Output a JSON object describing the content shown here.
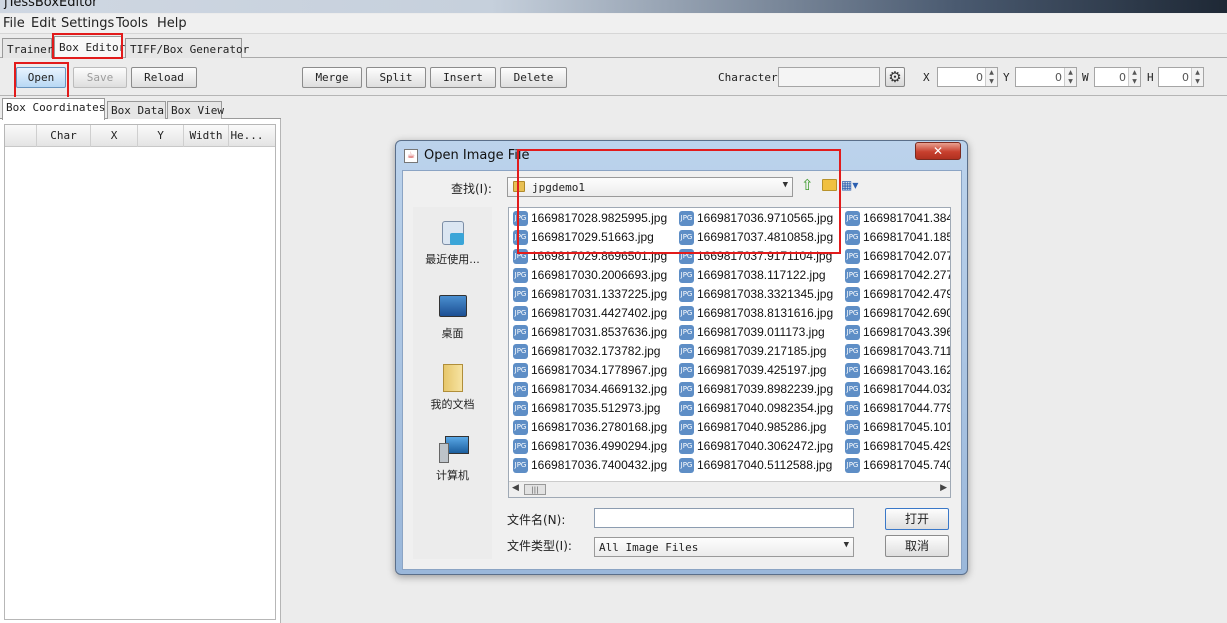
{
  "window": {
    "title": "jTessBoxEditor"
  },
  "menu": [
    "File",
    "Edit",
    "Settings",
    "Tools",
    "Help"
  ],
  "main_tabs": [
    "Trainer",
    "Box Editor",
    "TIFF/Box Generator"
  ],
  "toolbar": {
    "open": "Open",
    "save": "Save",
    "reload": "Reload",
    "merge": "Merge",
    "split": "Split",
    "insert": "Insert",
    "delete": "Delete",
    "character_label": "Character",
    "x_label": "X",
    "y_label": "Y",
    "w_label": "W",
    "h_label": "H",
    "x_value": "0",
    "y_value": "0",
    "w_value": "0",
    "h_value": "0",
    "gear_icon": "gear-icon"
  },
  "sub_tabs": [
    "Box Coordinates",
    "Box Data",
    "Box View"
  ],
  "table_columns": [
    "Char",
    "X",
    "Y",
    "Width",
    "He..."
  ],
  "dialog": {
    "title": "Open Image File",
    "lookin_label": "查找(I):",
    "folder": "jpgdemo1",
    "places": [
      "最近使用...",
      "桌面",
      "我的文档",
      "计算机"
    ],
    "files": [
      [
        "1669817028.9825995.jpg",
        "1669817029.51663.jpg",
        "1669817029.8696501.jpg",
        "1669817030.2006693.jpg",
        "1669817031.1337225.jpg",
        "1669817031.4427402.jpg",
        "1669817031.8537636.jpg",
        "1669817032.173782.jpg",
        "1669817034.1778967.jpg",
        "1669817034.4669132.jpg",
        "1669817035.512973.jpg",
        "1669817036.2780168.jpg",
        "1669817036.4990294.jpg",
        "1669817036.7400432.jpg"
      ],
      [
        "1669817036.9710565.jpg",
        "1669817037.4810858.jpg",
        "1669817037.9171104.jpg",
        "1669817038.117122.jpg",
        "1669817038.3321345.jpg",
        "1669817038.8131616.jpg",
        "1669817039.011173.jpg",
        "1669817039.217185.jpg",
        "1669817039.425197.jpg",
        "1669817039.8982239.jpg",
        "1669817040.0982354.jpg",
        "1669817040.985286.jpg",
        "1669817040.3062472.jpg",
        "1669817040.5112588.jpg"
      ],
      [
        "1669817041.384",
        "1669817041.185",
        "1669817042.077",
        "1669817042.277",
        "1669817042.479",
        "1669817042.690",
        "1669817043.396",
        "1669817043.711",
        "1669817043.162",
        "1669817044.032",
        "1669817044.779",
        "1669817045.101",
        "1669817045.429",
        "1669817045.740"
      ]
    ],
    "filename_label": "文件名(N):",
    "filename_value": "",
    "filetype_label": "文件类型(I):",
    "filetype_value": "All Image Files",
    "open_button": "打开",
    "cancel_button": "取消",
    "scroll_grip": "|||"
  }
}
